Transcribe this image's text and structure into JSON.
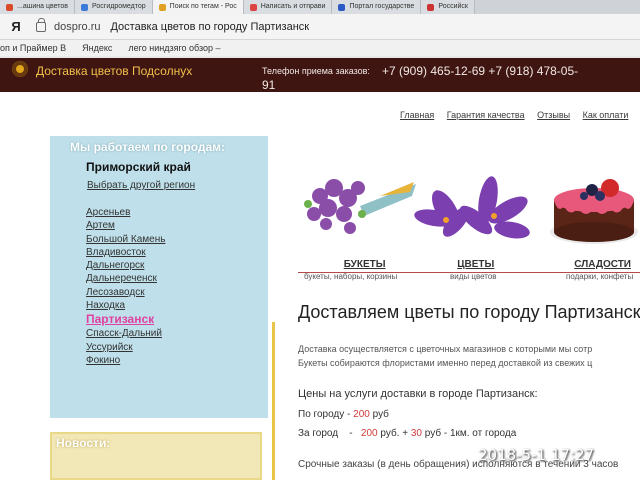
{
  "browser": {
    "tabs": [
      {
        "label": "...ашина цветов",
        "color": "#d94b2b"
      },
      {
        "label": "Росгидромедтор",
        "color": "#3a7ad9"
      },
      {
        "label": "Поиск по тегам - Рос",
        "color": "#e0a020"
      },
      {
        "label": "Написать и отправи",
        "color": "#d44"
      },
      {
        "label": "Портал государстве",
        "color": "#2a5bc4"
      },
      {
        "label": "Российск",
        "color": "#c33"
      }
    ],
    "address": {
      "nav_button": "Я",
      "domain": "dospro.ru",
      "title": "Доставка цветов по городу Партизанск"
    },
    "bookmarks": [
      "оп и Праймер В",
      "Яндекс",
      "лего ниндзяго обзор –"
    ]
  },
  "header": {
    "site_name": "Доставка цветов Подсолнух",
    "phone_label": "Телефон приема заказов:",
    "phones": "+7 (909) 465-12-69 +7 (918) 478-05-",
    "phones_wrap": "91"
  },
  "topnav": [
    "Главная",
    "Гарантия качества",
    "Отзывы",
    "Как оплати"
  ],
  "sidebar": {
    "title": "Мы работаем по городам:",
    "region": "Приморский край",
    "change_region": "Выбрать другой регион",
    "cities": [
      "Арсеньев",
      "Артем",
      "Большой Камень",
      "Владивосток",
      "Дальнегорск",
      "Дальнереченск",
      "Лесозаводск",
      "Находка",
      "Партизанск",
      "Спасск-Дальний",
      "Уссурийск",
      "Фокино"
    ],
    "active_city": "Партизанск",
    "news_title": "Новости:"
  },
  "categories": [
    {
      "title": "БУКЕТЫ",
      "subtitle": "букеты, наборы, корзины"
    },
    {
      "title": "ЦВЕТЫ",
      "subtitle": "виды цветов"
    },
    {
      "title": "СЛАДОСТИ",
      "subtitle": "подарки, конфеты"
    }
  ],
  "main": {
    "heading": "Доставляем цветы по городу Партизанск",
    "paragraph1": "Доставка осуществляется с цветочных магазинов с которыми мы сотр",
    "paragraph2": "Букеты собираются флористами именно перед доставкой из свежих ц",
    "prices_title": "Цены на услуги доставки в городе Партизанск:",
    "price_city_label": "По городу -",
    "price_city_value": "200",
    "price_city_unit": "руб",
    "price_out_label": "За город",
    "price_out_dash": "-",
    "price_out_value": "200",
    "price_out_mid": "руб. +",
    "price_out_extra": "30",
    "price_out_unit": "руб - 1км. от города",
    "urgent": "Срочные заказы (в день обращения) исполняются в течении 3 часов"
  },
  "photo_timestamp": "2018-5-1  17:27",
  "colors": {
    "header_bg": "#3f1512",
    "panel_bg": "#bfe0ea",
    "accent_pink": "#e040a0",
    "price_red": "#d13b3b"
  }
}
